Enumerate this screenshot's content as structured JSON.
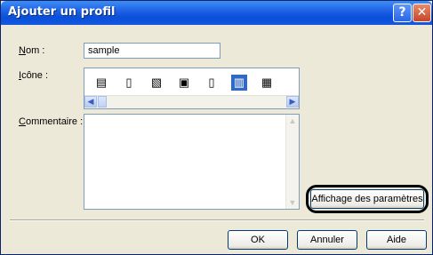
{
  "window": {
    "title": "Ajouter un profil",
    "help_glyph": "?",
    "close_glyph": "✕"
  },
  "form": {
    "name_label": "Nom :",
    "name_value": "sample",
    "icon_label": "Icône :",
    "icons": [
      {
        "name": "document-lines-icon",
        "glyph": "▤"
      },
      {
        "name": "document-red-icon",
        "glyph": "▯"
      },
      {
        "name": "document-image-icon",
        "glyph": "▧"
      },
      {
        "name": "picture-icon",
        "glyph": "▣"
      },
      {
        "name": "document-blank-icon",
        "glyph": "▯"
      },
      {
        "name": "document-columns-icon",
        "glyph": "▥"
      },
      {
        "name": "document-stack-icon",
        "glyph": "▦"
      }
    ],
    "selected_icon_index": 5,
    "comment_label": "Commentaire :",
    "comment_value": ""
  },
  "buttons": {
    "settings": "Affichage des paramètres",
    "ok": "OK",
    "cancel": "Annuler",
    "help": "Aide"
  },
  "colors": {
    "titlebar": "#0a4fd8",
    "selection": "#316ac5",
    "dialog_bg": "#ece9d8"
  }
}
